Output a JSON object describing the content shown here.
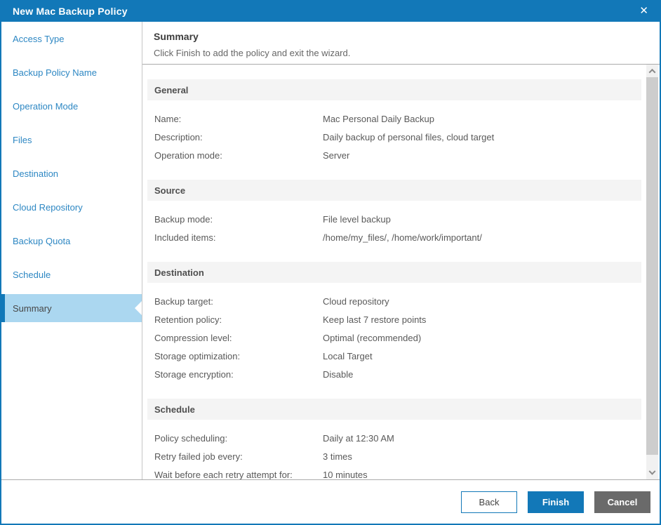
{
  "window": {
    "title": "New Mac Backup Policy",
    "close_icon": "✕"
  },
  "colors": {
    "accent_blue": "#1278b8",
    "sidebar_link": "#2d87c3",
    "selected_item_bg": "#abd7f0",
    "section_band_bg": "#f4f4f4",
    "body_text": "#595959",
    "cancel_gray": "#6a6a6a"
  },
  "sidebar": {
    "items": [
      {
        "label": "Access Type",
        "active": false
      },
      {
        "label": "Backup Policy Name",
        "active": false
      },
      {
        "label": "Operation Mode",
        "active": false
      },
      {
        "label": "Files",
        "active": false
      },
      {
        "label": "Destination",
        "active": false
      },
      {
        "label": "Cloud Repository",
        "active": false
      },
      {
        "label": "Backup Quota",
        "active": false
      },
      {
        "label": "Schedule",
        "active": false
      },
      {
        "label": "Summary",
        "active": true
      }
    ]
  },
  "step_header": {
    "title": "Summary",
    "subtitle": "Click Finish to add the policy and exit the wizard."
  },
  "summary_sections": [
    {
      "title": "General",
      "rows": [
        {
          "label": "Name:",
          "value": "Mac Personal Daily Backup"
        },
        {
          "label": "Description:",
          "value": "Daily backup of personal files, cloud target"
        },
        {
          "label": "Operation mode:",
          "value": "Server"
        }
      ]
    },
    {
      "title": "Source",
      "rows": [
        {
          "label": "Backup mode:",
          "value": "File level backup"
        },
        {
          "label": "Included items:",
          "value": "/home/my_files/, /home/work/important/"
        }
      ]
    },
    {
      "title": "Destination",
      "rows": [
        {
          "label": "Backup target:",
          "value": "Cloud repository"
        },
        {
          "label": "Retention policy:",
          "value": "Keep last 7 restore points"
        },
        {
          "label": "Compression level:",
          "value": "Optimal (recommended)"
        },
        {
          "label": "Storage optimization:",
          "value": "Local Target"
        },
        {
          "label": "Storage encryption:",
          "value": "Disable"
        }
      ]
    },
    {
      "title": "Schedule",
      "rows": [
        {
          "label": "Policy scheduling:",
          "value": "Daily at 12:30 AM"
        },
        {
          "label": "Retry failed job every:",
          "value": "3 times"
        },
        {
          "label": "Wait before each retry attempt for:",
          "value": "10 minutes"
        }
      ]
    }
  ],
  "footer": {
    "buttons": [
      {
        "label": "Back"
      },
      {
        "label": "Finish"
      },
      {
        "label": "Cancel"
      }
    ]
  }
}
